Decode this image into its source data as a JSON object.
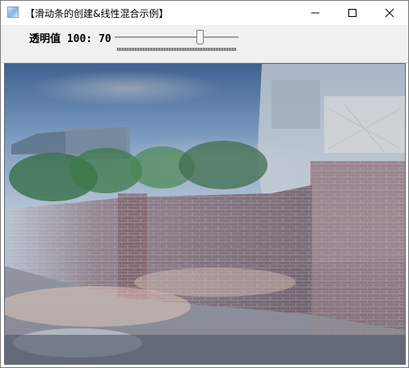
{
  "window": {
    "title": "【滑动条的创建&线性混合示例】",
    "controls": {
      "minimize_icon": "minimize-icon",
      "maximize_icon": "maximize-icon",
      "close_icon": "close-icon"
    }
  },
  "trackbar": {
    "label": "透明值 100: 70",
    "value": 70,
    "max": 100
  },
  "image": {
    "description_icon": "blended-image"
  },
  "colors": {
    "toolbar_bg": "#f0f0f0",
    "sky_top": "#4f6f9a",
    "sky_mid": "#9fb7cf",
    "brick": "#8a5a55",
    "ground": "#5b6670"
  }
}
